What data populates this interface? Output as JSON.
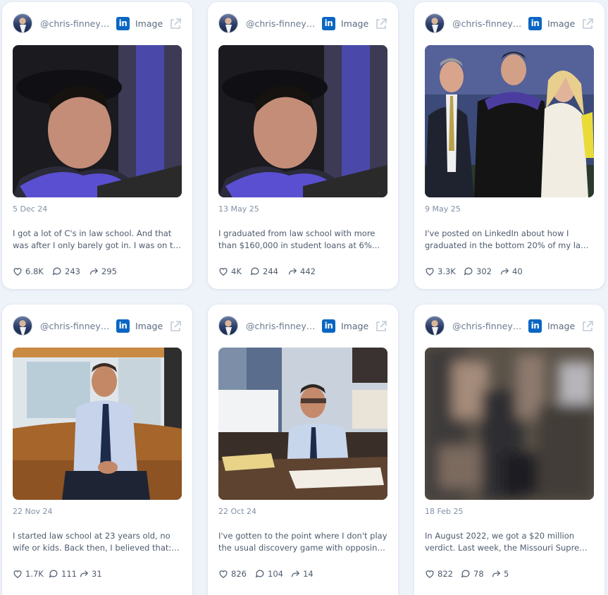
{
  "posts": [
    {
      "handle": "@chris-finney…",
      "type_label": "Image",
      "date": "5 Dec 24",
      "text_line1": "I got a lot of C's in law school. And that",
      "text_line2": "was after I only barely got in. I was on th…",
      "likes": "6.8K",
      "comments": "243",
      "shares": "295"
    },
    {
      "handle": "@chris-finney…",
      "type_label": "Image",
      "date": "13 May 25",
      "text_line1": "I graduated from law school with more",
      "text_line2": "than $160,000 in student loans at 6%…",
      "likes": "4K",
      "comments": "244",
      "shares": "442"
    },
    {
      "handle": "@chris-finney…",
      "type_label": "Image",
      "date": "9 May 25",
      "text_line1": "I've posted on LinkedIn about how I",
      "text_line2": "graduated in the bottom 20% of my law…",
      "likes": "3.3K",
      "comments": "302",
      "shares": "40"
    },
    {
      "handle": "@chris-finney…",
      "type_label": "Image",
      "date": "22 Nov 24",
      "text_line1": "I started law school at 23 years old, no",
      "text_line2": "wife or kids. Back then, I believed that: •…",
      "likes": "1.7K",
      "comments": "111",
      "shares": "31"
    },
    {
      "handle": "@chris-finney…",
      "type_label": "Image",
      "date": "22 Oct 24",
      "text_line1": "I've gotten to the point where I don't play",
      "text_line2": "the usual discovery game with opposin…",
      "likes": "826",
      "comments": "104",
      "shares": "14"
    },
    {
      "handle": "@chris-finney…",
      "type_label": "Image",
      "date": "18 Feb 25",
      "text_line1": "In August 2022, we got a $20 million",
      "text_line2": "verdict. Last week, the Missouri Supreme…",
      "likes": "822",
      "comments": "78",
      "shares": "5"
    }
  ],
  "linkedin_badge": "in",
  "icons": {
    "avatar": "profile-avatar",
    "platform": "linkedin-icon",
    "open": "external-link-icon",
    "likes": "heart-icon",
    "comments": "comment-icon",
    "shares": "share-arrow-icon"
  },
  "colors": {
    "background": "#eef2f9",
    "card": "#ffffff",
    "linkedin": "#0a66c2",
    "muted_text": "#8190a5",
    "body_text": "#4e5b6e"
  }
}
